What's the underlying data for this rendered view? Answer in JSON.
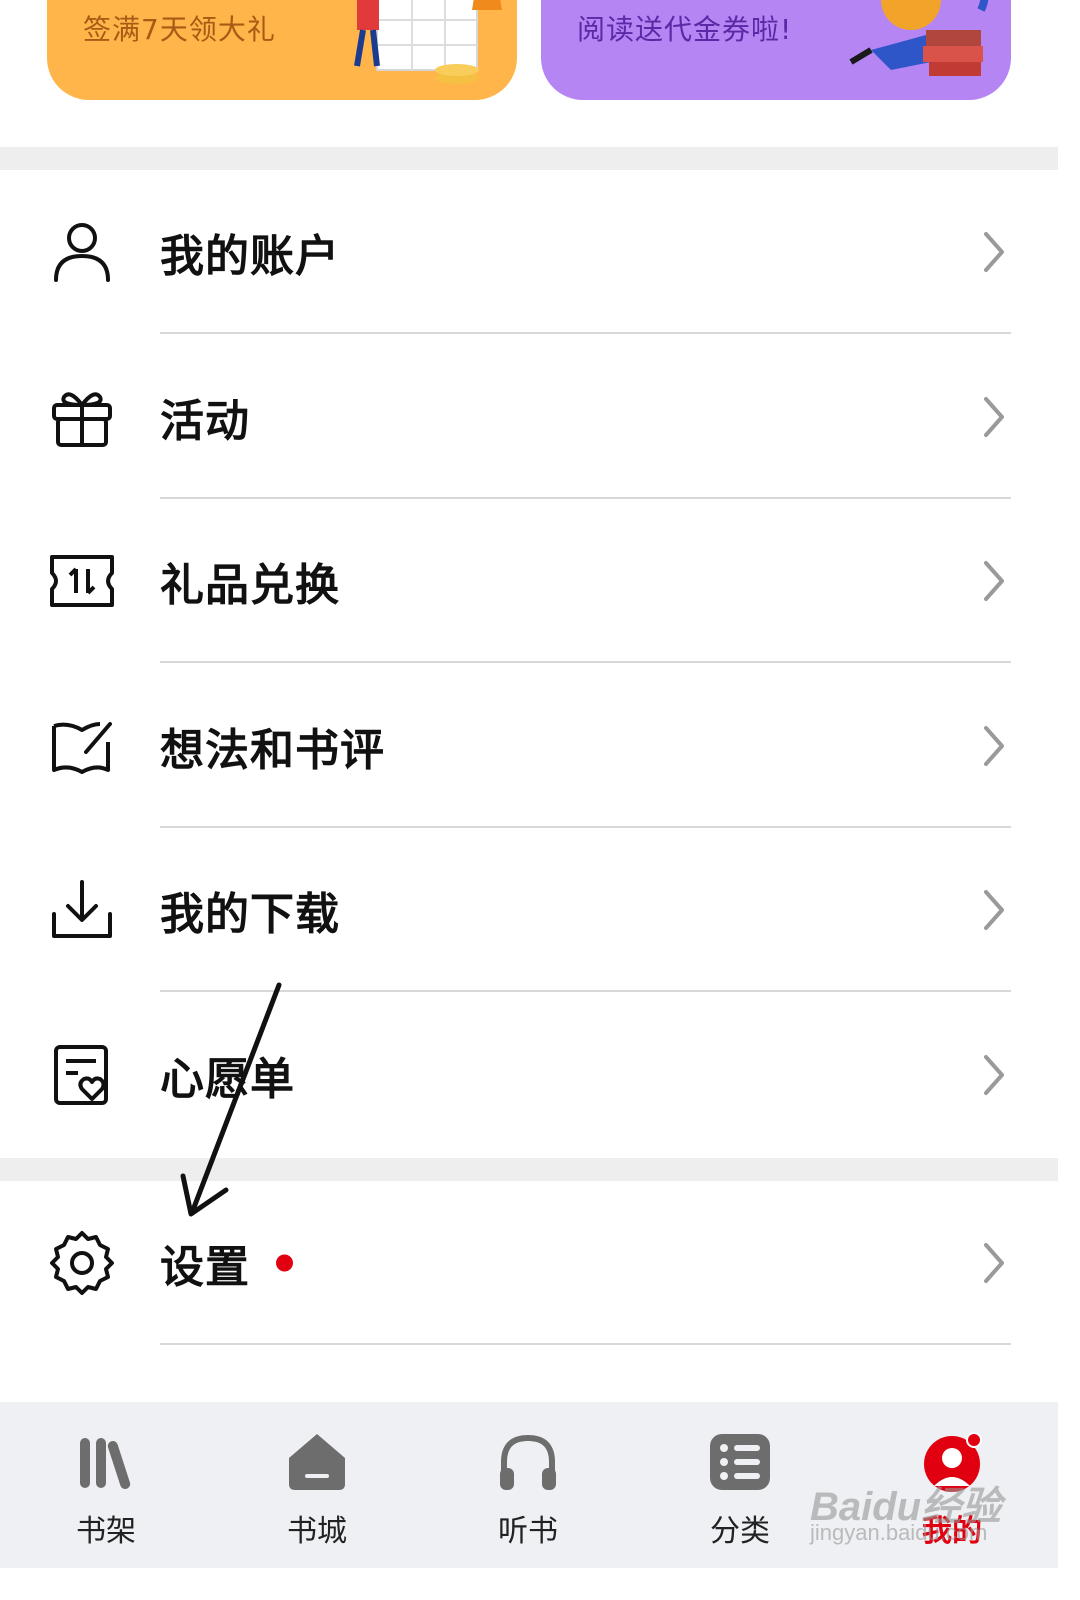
{
  "banners": [
    {
      "text": "签满7天领大礼",
      "color": "#ffb54a"
    },
    {
      "text": "阅读送代金券啦!",
      "color": "#b585f4"
    }
  ],
  "menu_group1": [
    {
      "label": "我的账户",
      "icon": "user-icon"
    },
    {
      "label": "活动",
      "icon": "gift-icon"
    },
    {
      "label": "礼品兑换",
      "icon": "ticket-exchange-icon"
    },
    {
      "label": "想法和书评",
      "icon": "book-edit-icon"
    },
    {
      "label": "我的下载",
      "icon": "download-icon"
    },
    {
      "label": "心愿单",
      "icon": "wishlist-icon"
    }
  ],
  "menu_group2": [
    {
      "label": "设置",
      "icon": "gear-icon",
      "badge": "red-dot"
    }
  ],
  "tabbar": {
    "items": [
      {
        "label": "书架",
        "icon": "bookshelf-icon"
      },
      {
        "label": "书城",
        "icon": "bookstore-icon"
      },
      {
        "label": "听书",
        "icon": "headphones-icon"
      },
      {
        "label": "分类",
        "icon": "category-list-icon"
      },
      {
        "label": "我的",
        "icon": "profile-avatar-icon",
        "active": true
      }
    ]
  },
  "watermark": {
    "line1": "Baidu经验",
    "line2": "jingyan.baidu.com"
  },
  "colors": {
    "accent": "#e1000f",
    "separator": "#eeeeee"
  }
}
